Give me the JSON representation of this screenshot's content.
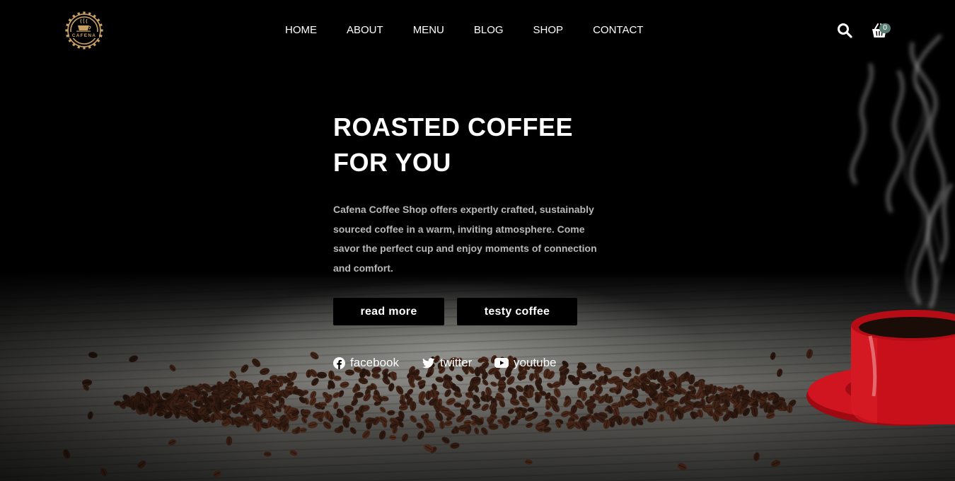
{
  "brand": {
    "logo_text": "CAFENA"
  },
  "nav": {
    "items": [
      {
        "label": "HOME"
      },
      {
        "label": "ABOUT"
      },
      {
        "label": "MENU"
      },
      {
        "label": "BLOG"
      },
      {
        "label": "SHOP"
      },
      {
        "label": "CONTACT"
      }
    ],
    "search_icon": "search-icon",
    "cart_icon": "shopping-basket-icon",
    "cart_count": "0"
  },
  "hero": {
    "title_line1": "ROASTED COFFEE",
    "title_line2": "FOR YOU",
    "description": "Cafena Coffee Shop offers expertly crafted, sustainably sourced coffee in a warm, inviting atmosphere. Come savor the perfect cup and enjoy moments of connection and comfort.",
    "buttons": {
      "read_more": "read more",
      "testy_coffee": "testy coffee"
    }
  },
  "social": [
    {
      "label": "facebook",
      "icon": "facebook-icon"
    },
    {
      "label": "twitter",
      "icon": "twitter-icon"
    },
    {
      "label": "youtube",
      "icon": "youtube-icon"
    }
  ],
  "colors": {
    "background": "#000000",
    "cup_red": "#c8101a",
    "logo_gold": "#c9a063",
    "badge": "#5a7e73",
    "text_muted": "#b8b8b8"
  }
}
